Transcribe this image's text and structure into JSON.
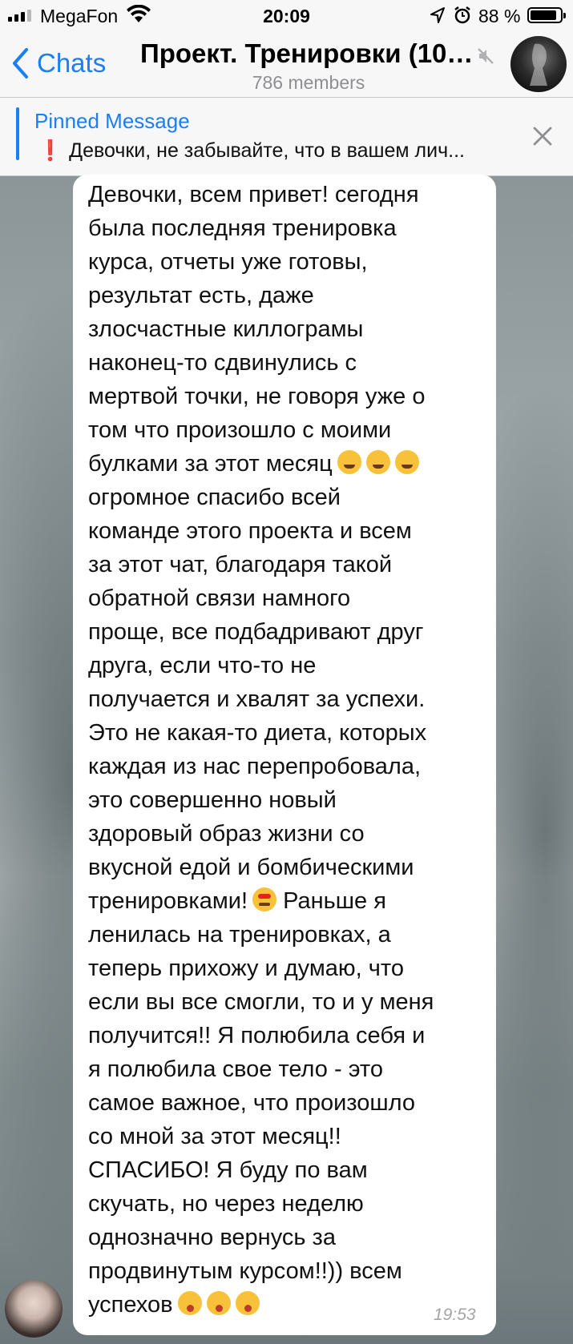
{
  "status_bar": {
    "carrier": "MegaFon",
    "time": "20:09",
    "battery": "88 %"
  },
  "nav": {
    "back_label": "Chats",
    "title": "Проект. Тренировки (10:...",
    "members": "786 members"
  },
  "pinned": {
    "title": "Pinned Message",
    "text": "Девочки, не забывайте, что в вашем лич..."
  },
  "message": {
    "lines": [
      "Девочки, всем привет! сегодня",
      "была последняя тренировка",
      "курса, отчеты уже готовы,",
      "результат есть, даже",
      "злосчастные киллограмы",
      "наконец-то сдвинулись с",
      "мертвой точки, не говоря уже о",
      "том что произошло с моими",
      "булками за этот месяц",
      "огромное спасибо всей",
      "команде этого проекта и всем",
      "за этот чат, благодаря такой",
      "обратной связи намного",
      "проще, все подбадривают друг",
      "друга, если что-то не",
      "получается и хвалят за успехи.",
      "Это не какая-то диета, которых",
      "каждая из нас перепробовала,",
      "это совершенно новый",
      "здоровый образ жизни со",
      "вкусной едой и бомбическими",
      "тренировками!",
      "ленилась на тренировках, а",
      "теперь прихожу и думаю, что",
      "если вы все смогли, то и у меня",
      "получится!! Я полюбила себя и",
      "я полюбила свое тело - это",
      "самое важное, что произошло",
      "со мной за этот месяц!!",
      "СПАСИБО! Я буду по вам",
      "скучать, но через неделю",
      "однозначно вернусь за",
      "продвинутым курсом!!)) всем",
      "успехов"
    ],
    "line_21_tail": "Раньше я",
    "time": "19:53"
  }
}
